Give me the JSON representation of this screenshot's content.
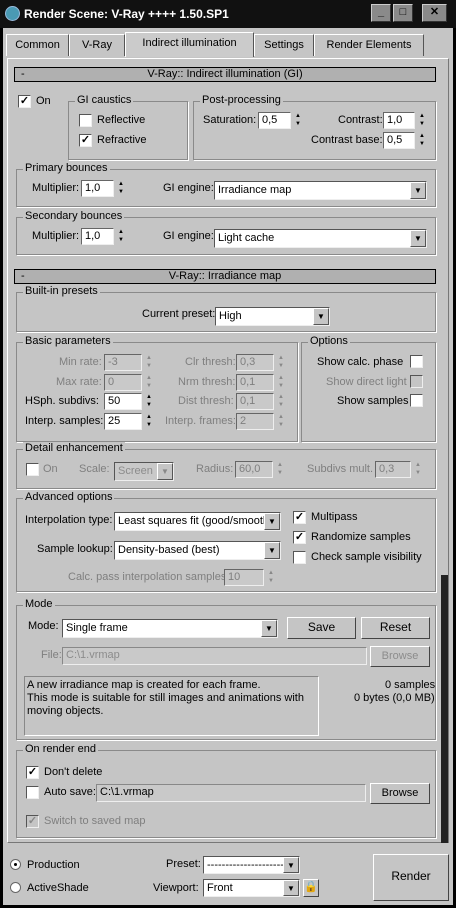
{
  "window": {
    "title": "Render Scene: V-Ray ++++ 1.50.SP1"
  },
  "tabs": [
    "Common",
    "V-Ray",
    "Indirect illumination",
    "Settings",
    "Render Elements"
  ],
  "gi": {
    "rollout_title": "V-Ray:: Indirect illumination (GI)",
    "collapse": "-",
    "on_label": "On",
    "caustics": {
      "title": "GI caustics",
      "reflective": "Reflective",
      "refractive": "Refractive"
    },
    "post": {
      "title": "Post-processing",
      "saturation_label": "Saturation:",
      "saturation": "0,5",
      "contrast_label": "Contrast:",
      "contrast": "1,0",
      "contrast_base_label": "Contrast base:",
      "contrast_base": "0,5"
    },
    "primary": {
      "title": "Primary bounces",
      "multiplier_label": "Multiplier:",
      "multiplier": "1,0",
      "engine_label": "GI engine:",
      "engine": "Irradiance map"
    },
    "secondary": {
      "title": "Secondary bounces",
      "multiplier_label": "Multiplier:",
      "multiplier": "1,0",
      "engine_label": "GI engine:",
      "engine": "Light cache"
    }
  },
  "irr": {
    "rollout_title": "V-Ray:: Irradiance map",
    "collapse": "-",
    "presets": {
      "title": "Built-in presets",
      "current_label": "Current preset:",
      "current": "High"
    },
    "basic": {
      "title": "Basic parameters",
      "min_rate_label": "Min rate:",
      "min_rate": "-3",
      "max_rate_label": "Max rate:",
      "max_rate": "0",
      "hsph_label": "HSph. subdivs:",
      "hsph": "50",
      "interp_samples_label": "Interp. samples:",
      "interp_samples": "25",
      "clr_label": "Clr thresh:",
      "clr": "0,3",
      "nrm_label": "Nrm thresh:",
      "nrm": "0,1",
      "dist_label": "Dist thresh:",
      "dist": "0,1",
      "interp_frames_label": "Interp. frames:",
      "interp_frames": "2"
    },
    "options": {
      "title": "Options",
      "calc_phase": "Show calc. phase",
      "direct_light": "Show direct light",
      "samples": "Show samples"
    },
    "detail": {
      "title": "Detail enhancement",
      "on_label": "On",
      "scale_label": "Scale:",
      "scale": "Screen",
      "radius_label": "Radius:",
      "radius": "60,0",
      "subdivs_label": "Subdivs mult.",
      "subdivs": "0,3"
    },
    "advanced": {
      "title": "Advanced options",
      "interp_type_label": "Interpolation type:",
      "interp_type": "Least squares fit (good/smooth",
      "sample_lookup_label": "Sample lookup:",
      "sample_lookup": "Density-based (best)",
      "calc_pass_label": "Calc. pass interpolation samples:",
      "calc_pass": "10",
      "multipass": "Multipass",
      "randomize": "Randomize samples",
      "check_vis": "Check sample visibility"
    },
    "mode": {
      "title": "Mode",
      "mode_label": "Mode:",
      "mode": "Single frame",
      "save": "Save",
      "reset": "Reset",
      "file_label": "File:",
      "file": "C:\\1.vrmap",
      "browse": "Browse",
      "desc1": "A new irradiance map is created for each frame.",
      "desc2": "This mode is suitable for still images and animations with",
      "desc3": "moving objects.",
      "samples": "0 samples",
      "bytes": "0 bytes (0,0 MB)"
    },
    "end": {
      "title": "On render end",
      "dont_delete": "Don't delete",
      "auto_save": "Auto save:",
      "auto_file": "C:\\1.vrmap",
      "browse": "Browse",
      "switch": "Switch to saved map"
    }
  },
  "bottom": {
    "production": "Production",
    "activeshade": "ActiveShade",
    "preset_label": "Preset:",
    "preset": "-------------------------",
    "viewport_label": "Viewport:",
    "viewport": "Front",
    "render": "Render"
  }
}
